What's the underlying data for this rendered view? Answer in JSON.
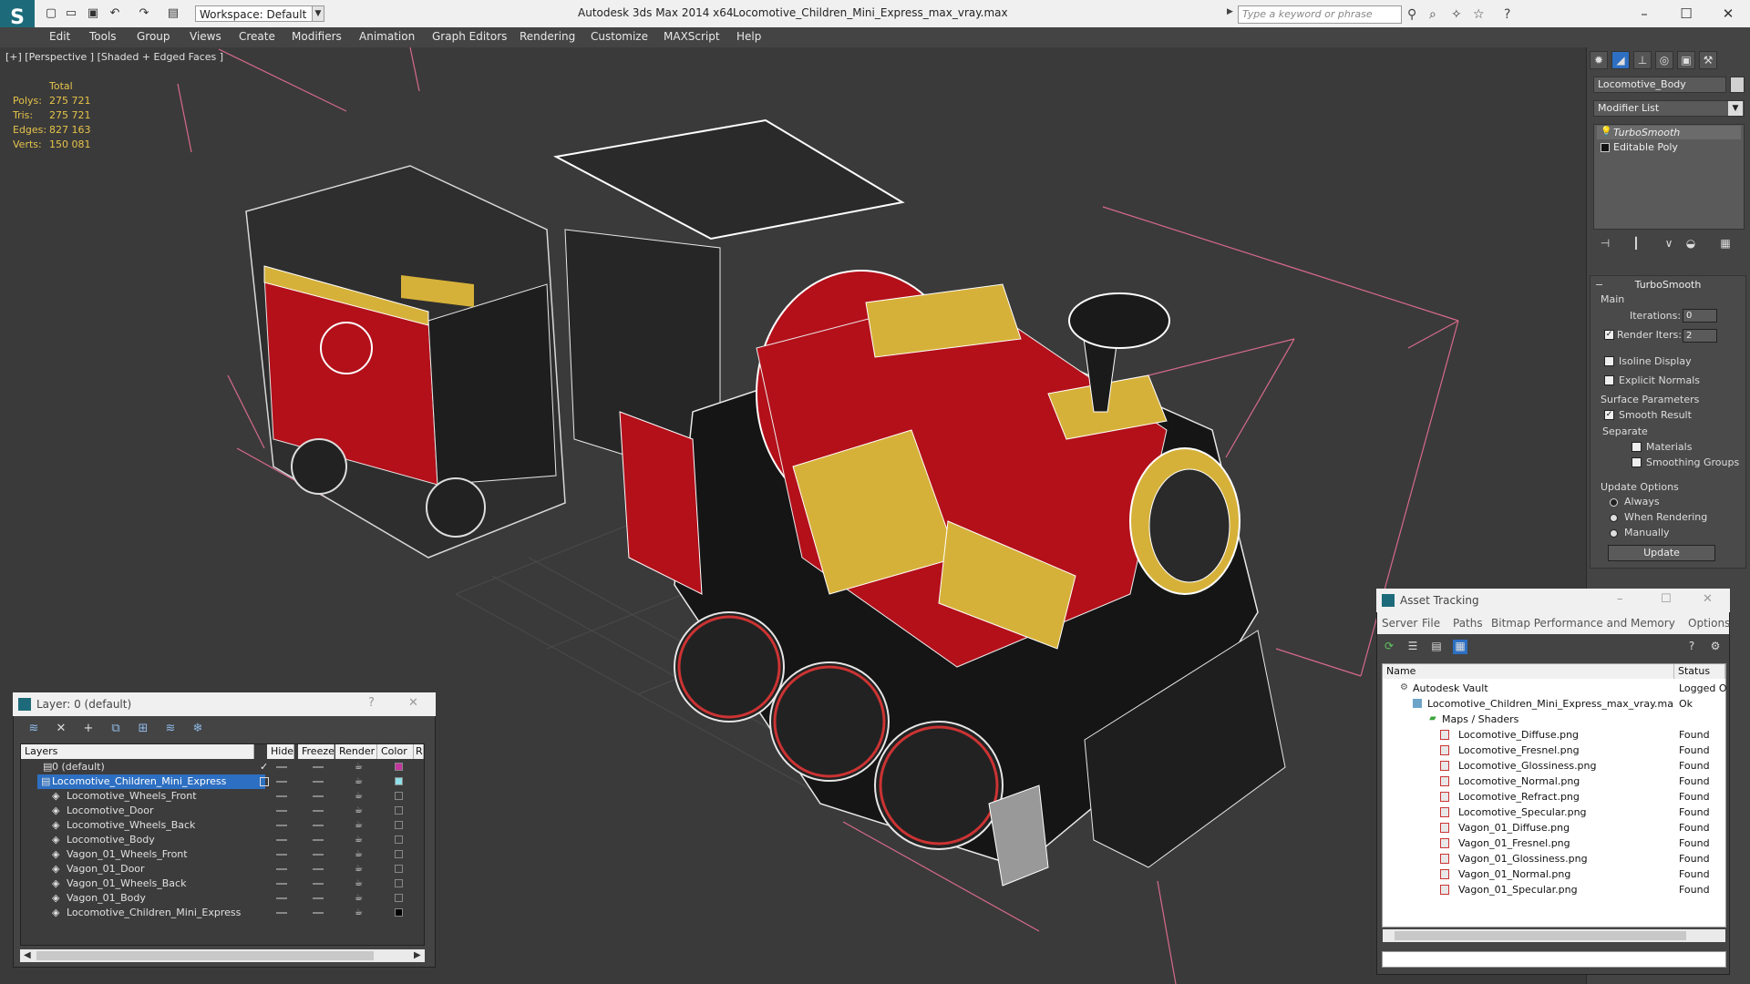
{
  "titlebar": {
    "app_title": "Autodesk 3ds Max  2014 x64",
    "file_title": "Locomotive_Children_Mini_Express_max_vray.max",
    "workspace": "Workspace: Default",
    "search_placeholder": "Type a keyword or phrase"
  },
  "menu": [
    "Edit",
    "Tools",
    "Group",
    "Views",
    "Create",
    "Modifiers",
    "Animation",
    "Graph Editors",
    "Rendering",
    "Customize",
    "MAXScript",
    "Help"
  ],
  "viewport": {
    "label": "[+] [Perspective ] [Shaded + Edged Faces ]",
    "stats_header": "Total",
    "stats": [
      {
        "label": "Polys:",
        "value": "275 721"
      },
      {
        "label": "Tris:",
        "value": "275 721"
      },
      {
        "label": "Edges:",
        "value": "827 163"
      },
      {
        "label": "Verts:",
        "value": "150 081"
      }
    ]
  },
  "command_panel": {
    "object_name": "Locomotive_Body",
    "modifier_list": "Modifier List",
    "stack": [
      "TurboSmooth",
      "Editable Poly"
    ],
    "rollout_title": "TurboSmooth",
    "main_label": "Main",
    "iterations_label": "Iterations:",
    "iterations_value": "0",
    "render_iters_label": "Render Iters:",
    "render_iters_value": "2",
    "isoline_display": "Isoline Display",
    "explicit_normals": "Explicit Normals",
    "surface_parameters": "Surface Parameters",
    "smooth_result": "Smooth Result",
    "separate": "Separate",
    "materials": "Materials",
    "smoothing_groups": "Smoothing Groups",
    "update_options": "Update Options",
    "always": "Always",
    "when_rendering": "When Rendering",
    "manually": "Manually",
    "update_button": "Update"
  },
  "asset_tracking": {
    "title": "Asset Tracking",
    "menu": [
      "Server",
      "File",
      "Paths",
      "Bitmap Performance and Memory",
      "Options"
    ],
    "col_name": "Name",
    "col_status": "Status",
    "rows": [
      {
        "name": "Autodesk Vault",
        "status": "Logged O"
      },
      {
        "name": "Locomotive_Children_Mini_Express_max_vray.max",
        "status": "Ok"
      },
      {
        "name": "Maps / Shaders",
        "status": ""
      },
      {
        "name": "Locomotive_Diffuse.png",
        "status": "Found"
      },
      {
        "name": "Locomotive_Fresnel.png",
        "status": "Found"
      },
      {
        "name": "Locomotive_Glossiness.png",
        "status": "Found"
      },
      {
        "name": "Locomotive_Normal.png",
        "status": "Found"
      },
      {
        "name": "Locomotive_Refract.png",
        "status": "Found"
      },
      {
        "name": "Locomotive_Specular.png",
        "status": "Found"
      },
      {
        "name": "Vagon_01_Diffuse.png",
        "status": "Found"
      },
      {
        "name": "Vagon_01_Fresnel.png",
        "status": "Found"
      },
      {
        "name": "Vagon_01_Glossiness.png",
        "status": "Found"
      },
      {
        "name": "Vagon_01_Normal.png",
        "status": "Found"
      },
      {
        "name": "Vagon_01_Specular.png",
        "status": "Found"
      }
    ]
  },
  "layer_explorer": {
    "title": "Layer: 0 (default)",
    "headers": [
      "Layers",
      "Hide",
      "Freeze",
      "Render",
      "Color",
      "R"
    ],
    "rows": [
      {
        "name": "0 (default)",
        "color": "#c2359c"
      },
      {
        "name": "Locomotive_Children_Mini_Express",
        "color": "#8fe0e8"
      },
      {
        "name": "Locomotive_Wheels_Front",
        "color": ""
      },
      {
        "name": "Locomotive_Door",
        "color": ""
      },
      {
        "name": "Locomotive_Wheels_Back",
        "color": ""
      },
      {
        "name": "Locomotive_Body",
        "color": ""
      },
      {
        "name": "Vagon_01_Wheels_Front",
        "color": ""
      },
      {
        "name": "Vagon_01_Door",
        "color": ""
      },
      {
        "name": "Vagon_01_Wheels_Back",
        "color": ""
      },
      {
        "name": "Vagon_01_Body",
        "color": ""
      },
      {
        "name": "Locomotive_Children_Mini_Express",
        "color": "#000000"
      }
    ]
  },
  "colors": {
    "accent": "#2d6fc2",
    "stats": "#e6c34a",
    "train_red": "#b3101a",
    "train_yellow": "#d6b13a"
  }
}
